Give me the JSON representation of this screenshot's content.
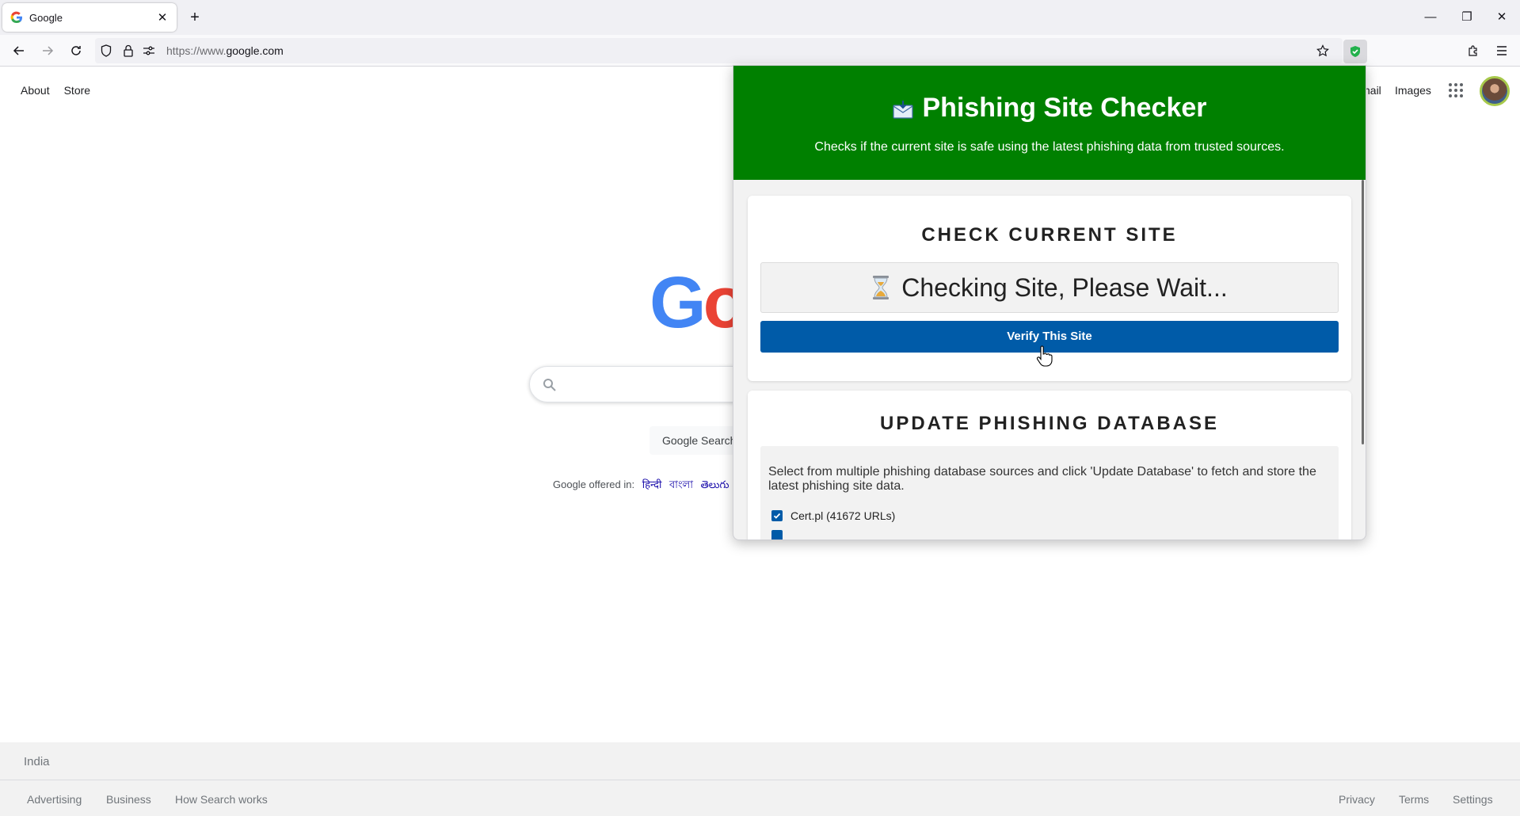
{
  "browser": {
    "tab_title": "Google",
    "url_scheme": "https://www.",
    "url_host": "google.com"
  },
  "google": {
    "top_left_links": [
      "About",
      "Store"
    ],
    "top_right_mail": "nail",
    "top_right_images": "Images",
    "logo_visible": "Go",
    "search_button": "Google Search",
    "offered_in_label": "Google offered in:",
    "languages": [
      "हिन्दी",
      "বাংলা",
      "తెలుగు"
    ],
    "country": "India",
    "footer_left": [
      "Advertising",
      "Business",
      "How Search works"
    ],
    "footer_right": [
      "Privacy",
      "Terms",
      "Settings"
    ]
  },
  "popup": {
    "title": "Phishing Site Checker",
    "subtitle": "Checks if the current site is safe using the latest phishing data from trusted sources.",
    "check_heading": "CHECK CURRENT SITE",
    "status_text": "Checking Site, Please Wait...",
    "verify_button": "Verify This Site",
    "update_heading": "UPDATE PHISHING DATABASE",
    "update_info": "Select from multiple phishing database sources and click 'Update Database' to fetch and store the latest phishing site data.",
    "sources": [
      {
        "label": "Cert.pl (41672 URLs)",
        "checked": true
      }
    ],
    "header_color": "#008000",
    "button_color": "#005ba8"
  },
  "icons": {
    "hourglass": "⌛",
    "envelope": "📩"
  }
}
